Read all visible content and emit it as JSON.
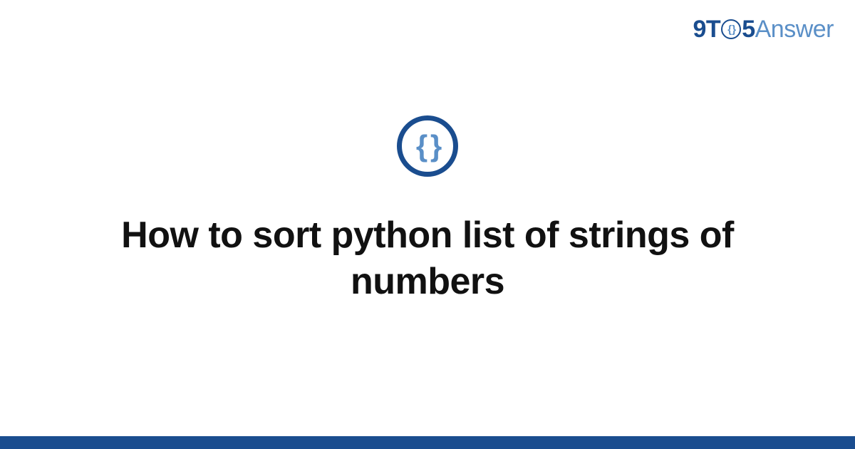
{
  "brand": {
    "nine": "9",
    "t": "T",
    "o_inner": "{ }",
    "five": "5",
    "answer": "Answer"
  },
  "icon": {
    "braces": "{ }"
  },
  "title": "How to sort python list of strings of numbers",
  "colors": {
    "primary": "#1a4d8f",
    "secondary": "#5a8fc7",
    "text": "#111111",
    "background": "#ffffff"
  }
}
